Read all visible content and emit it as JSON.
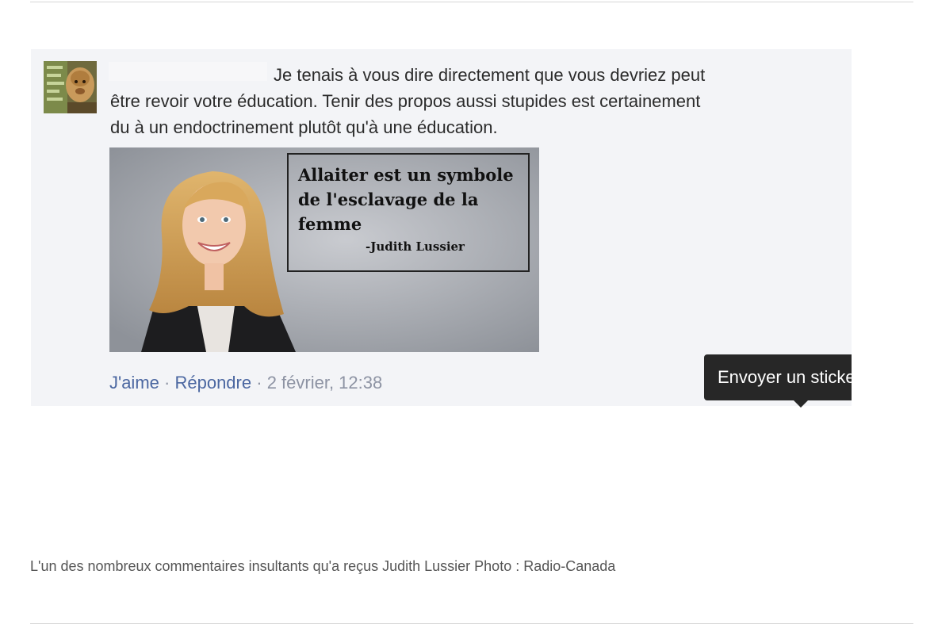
{
  "comment": {
    "line1": "Je tenais à vous dire directement que vous devriez peut",
    "line2": "être revoir votre éducation. Tenir des propos aussi stupides est certainement",
    "line3": "du à un endoctrinement plutôt qu'à une éducation."
  },
  "image": {
    "quote_line1": "Allaiter est un symbole",
    "quote_line2": "de l'esclavage de la",
    "quote_line3": "femme",
    "quote_author": "-Judith Lussier"
  },
  "actions": {
    "like": "J'aime",
    "separator": "·",
    "reply": "Répondre",
    "timestamp": "2 février, 12:38"
  },
  "tooltip": {
    "label": "Envoyer un sticker"
  },
  "caption": {
    "text": "L'un des nombreux commentaires insultants qu'a reçus Judith Lussier Photo : Radio-Canada"
  },
  "colors": {
    "link": "#4b67a1",
    "card_background": "#f3f4f7",
    "tooltip_background": "#272727"
  }
}
